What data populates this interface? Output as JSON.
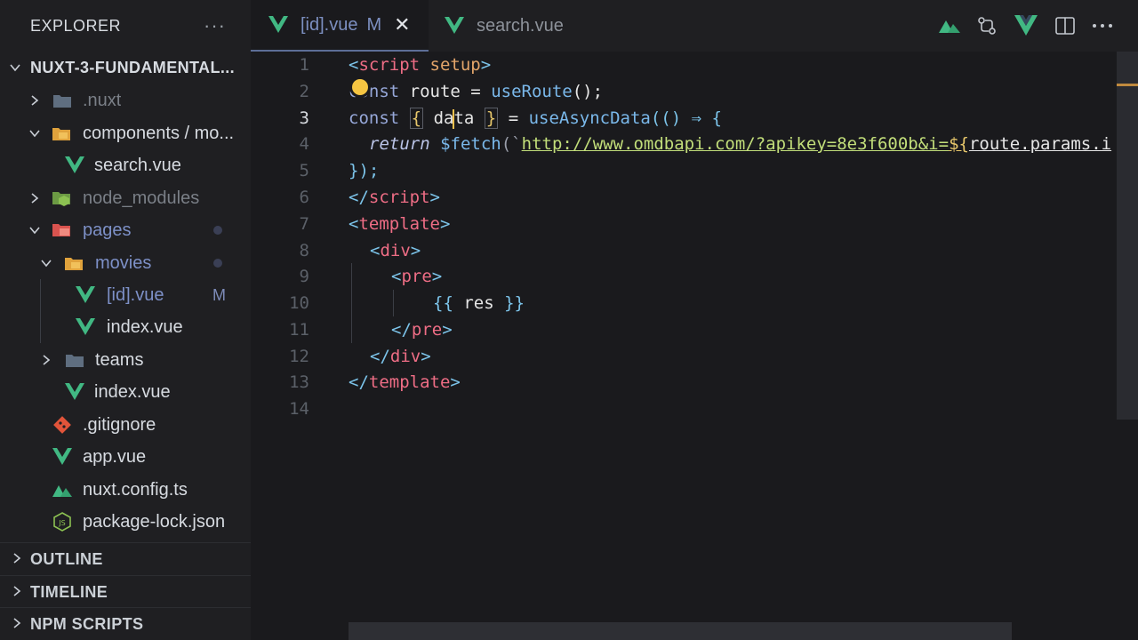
{
  "sidebar": {
    "title": "EXPLORER",
    "more_label": "···",
    "root": "NUXT-3-FUNDAMENTAL...",
    "tree": [
      {
        "label": ".nuxt"
      },
      {
        "label": "components / mo..."
      },
      {
        "label": "search.vue"
      },
      {
        "label": "node_modules"
      },
      {
        "label": "pages"
      },
      {
        "label": "movies"
      },
      {
        "label": "[id].vue",
        "badge": "M"
      },
      {
        "label": "index.vue"
      },
      {
        "label": "teams"
      },
      {
        "label": "index.vue"
      },
      {
        "label": ".gitignore"
      },
      {
        "label": "app.vue"
      },
      {
        "label": "nuxt.config.ts"
      },
      {
        "label": "package-lock.json"
      }
    ],
    "sections": [
      "OUTLINE",
      "TIMELINE",
      "NPM SCRIPTS"
    ]
  },
  "tabs": [
    {
      "label": "[id].vue",
      "badge": "M",
      "close": "✕",
      "active": true
    },
    {
      "label": "search.vue",
      "active": false
    }
  ],
  "editor": {
    "line_numbers": [
      "1",
      "2",
      "3",
      "4",
      "5",
      "6",
      "7",
      "8",
      "9",
      "10",
      "11",
      "12",
      "13",
      "14"
    ],
    "current_line": 3,
    "tokens": {
      "l1_open": "<",
      "l1_tag": "script",
      "l1_attr": "setup",
      "l1_close": ">",
      "l2_kw": "const",
      "l2_id": "route",
      "l2_eq": " = ",
      "l2_fn": "useRoute",
      "l2_end": "();",
      "l3_kw": "const",
      "l3_lb": "{",
      "l3_da": "da",
      "l3_ta": "ta",
      "l3_rb": "}",
      "l3_eq": " = ",
      "l3_fn": "useAsyncData",
      "l3_rest": "(() ⇒ {",
      "l4_ret": "return",
      "l4_fn": "$fetch",
      "l4_paren": "(`",
      "l4_str": "http://www.omdbapi.com/?apikey=8e3f600b&i=",
      "l4_interp": "${",
      "l4_expr": "route.params.i",
      "l5": "});",
      "l6_open": "</",
      "l6_tag": "script",
      "l6_close": ">",
      "l7_open": "<",
      "l7_tag": "template",
      "l7_close": ">",
      "l8_open": "<",
      "l8_tag": "div",
      "l8_close": ">",
      "l9_open": "<",
      "l9_tag": "pre",
      "l9_close": ">",
      "l10_open": "{{",
      "l10_id": " res ",
      "l10_close": "}}",
      "l11_open": "</",
      "l11_tag": "pre",
      "l11_close": ">",
      "l12_open": "</",
      "l12_tag": "div",
      "l12_close": ">",
      "l13_open": "</",
      "l13_tag": "template",
      "l13_close": ">"
    }
  }
}
